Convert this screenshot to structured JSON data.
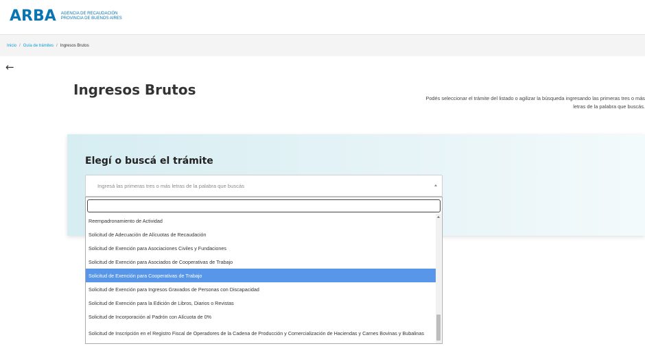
{
  "header": {
    "logo_text": "ARBA",
    "logo_line1": "AGENCIA DE RECAUDACIÓN",
    "logo_line2": "PROVINCIA DE BUENOS AIRES",
    "brand_color": "#0a75b5"
  },
  "breadcrumb": {
    "items": [
      "Inicio",
      "Guía de trámites"
    ],
    "separator": "/",
    "current": "Ingresos Brutos"
  },
  "page": {
    "back_icon": "arrow-left-icon",
    "title": "Ingresos Brutos",
    "hint_line1": "Podés seleccionar el trámite del listado o agilizar la búsqueda ingresando las primeras tres o más",
    "hint_line2": "letras de la palabra que buscás."
  },
  "search": {
    "card_title": "Elegí o buscá el trámite",
    "placeholder": "Ingresá las primeras tres o más letras de la palabra que buscás",
    "dropdown_search_value": "",
    "selected_color": "#5896e9",
    "options": [
      "Reempadronamiento de Actividad",
      "Solicitud de Adecuación de Alícuotas de Recaudación",
      "Solicitud de Exención para Asociaciones Civiles y Fundaciones",
      "Solicitud de Exención para Asociados de Cooperativas de Trabajo",
      "Solicitud de Exención para Cooperativas de Trabajo",
      "Solicitud de Exención para Ingresos Gravados de Personas con Discapacidad",
      "Solicitud de Exención para la Edición de Libros, Diarios o Revistas",
      "Solicitud de Incorporación al Padrón con Alícuota de 0%",
      "Solicitud de Inscripción en el Registro Fiscal de Operadores de la Cadena de Producción y Comercialización de Haciendas y Carnes Bovinas y Bubalinas"
    ],
    "highlighted_index": 4
  }
}
